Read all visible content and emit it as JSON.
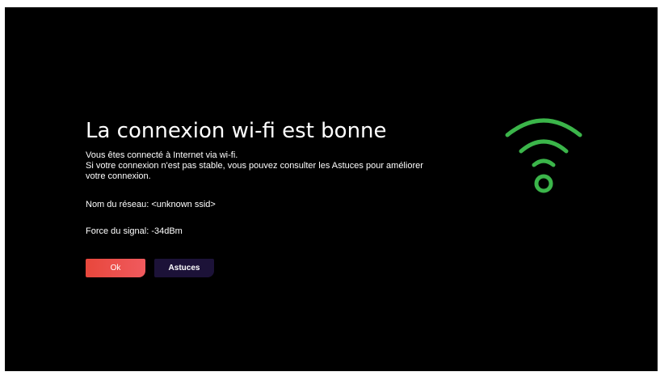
{
  "dialog": {
    "title": "La connexion wi-fi est bonne",
    "description_lines": [
      "Vous êtes connecté à Internet via wi-fi.",
      "Si votre connexion n'est pas stable, vous pouvez consulter les Astuces pour améliorer",
      "votre connexion."
    ],
    "network_name": "Nom du réseau: <unknown ssid>",
    "signal_strength": "Force du signal: -34dBm"
  },
  "buttons": {
    "ok_label": "Ok",
    "tips_label": "Astuces"
  },
  "icon": {
    "name": "wifi-icon",
    "color": "#3bb54a"
  },
  "colors": {
    "background": "#000000",
    "ok_button": "#e8473c",
    "tips_button": "#1c1238",
    "text": "#ffffff"
  }
}
